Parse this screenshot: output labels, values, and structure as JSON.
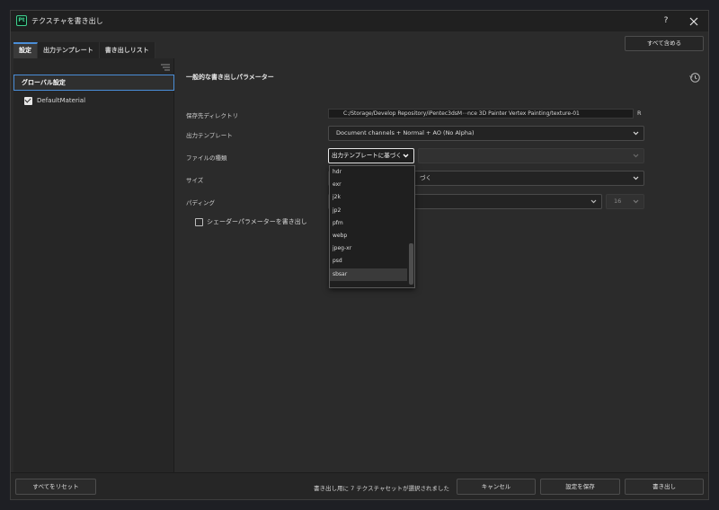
{
  "window": {
    "app_icon_text": "Pt",
    "title": "テクスチャを書き出し",
    "help_label": "?"
  },
  "tabs": [
    {
      "label": "設定"
    },
    {
      "label": "出力テンプレート"
    },
    {
      "label": "書き出しリスト"
    }
  ],
  "header": {
    "include_all_label": "すべて含める"
  },
  "sidebar": {
    "global_settings_label": "グローバル設定",
    "material": {
      "label": "DefaultMaterial",
      "checked": true
    }
  },
  "main": {
    "section_title": "一般的な書き出しパラメーター",
    "fields": {
      "output_dir": {
        "label": "保存先ディレクトリ",
        "value": "C:/Storage/Develop Repository/iPentec3dsM⋯nce 3D Painter Vertex Painting/texture-01",
        "suffix": "R"
      },
      "output_template": {
        "label": "出力テンプレート",
        "value": "Document channels + Normal + AO (No Alpha)"
      },
      "file_type": {
        "label": "ファイルの種類",
        "value": "出力テンプレートに基づく"
      },
      "size": {
        "label": "サイズ",
        "value": "づく"
      },
      "padding": {
        "label": "パディング",
        "value": "",
        "secondary_value": "16"
      },
      "shader_params": {
        "label": "シェーダーパラメーターを書き出し",
        "checked": false
      }
    },
    "file_type_options": [
      "hdr",
      "exr",
      "j2k",
      "jp2",
      "pfm",
      "webp",
      "jpeg-xr",
      "psd",
      "sbsar"
    ],
    "hovered_option": "sbsar"
  },
  "footer": {
    "reset_all_label": "すべてをリセット",
    "status_text": "書き出し用に 7 テクスチャセットが選択されました",
    "cancel_label": "キャンセル",
    "save_settings_label": "設定を保存",
    "export_label": "書き出し"
  },
  "colors": {
    "accent": "#4a8ed8",
    "app_icon": "#3fcf8e",
    "background": "#2b2b2b"
  }
}
